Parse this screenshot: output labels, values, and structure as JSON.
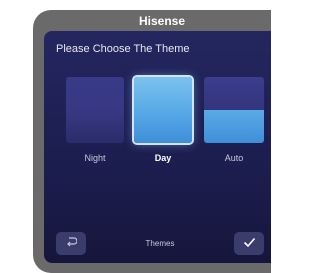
{
  "device": {
    "brand": "Hisense"
  },
  "screen": {
    "title": "Please Choose The Theme",
    "themes": [
      {
        "label": "Night",
        "selected": false
      },
      {
        "label": "Day",
        "selected": true
      },
      {
        "label": "Auto",
        "selected": false
      }
    ],
    "footer": {
      "label": "Themes",
      "back_icon": "back-arrow-icon",
      "confirm_icon": "checkmark-icon"
    }
  },
  "colors": {
    "screen_bg": "#1c1e50",
    "day_theme": "#55a8e6",
    "night_theme": "#3a3a86",
    "bezel": "#6a6a6a"
  }
}
